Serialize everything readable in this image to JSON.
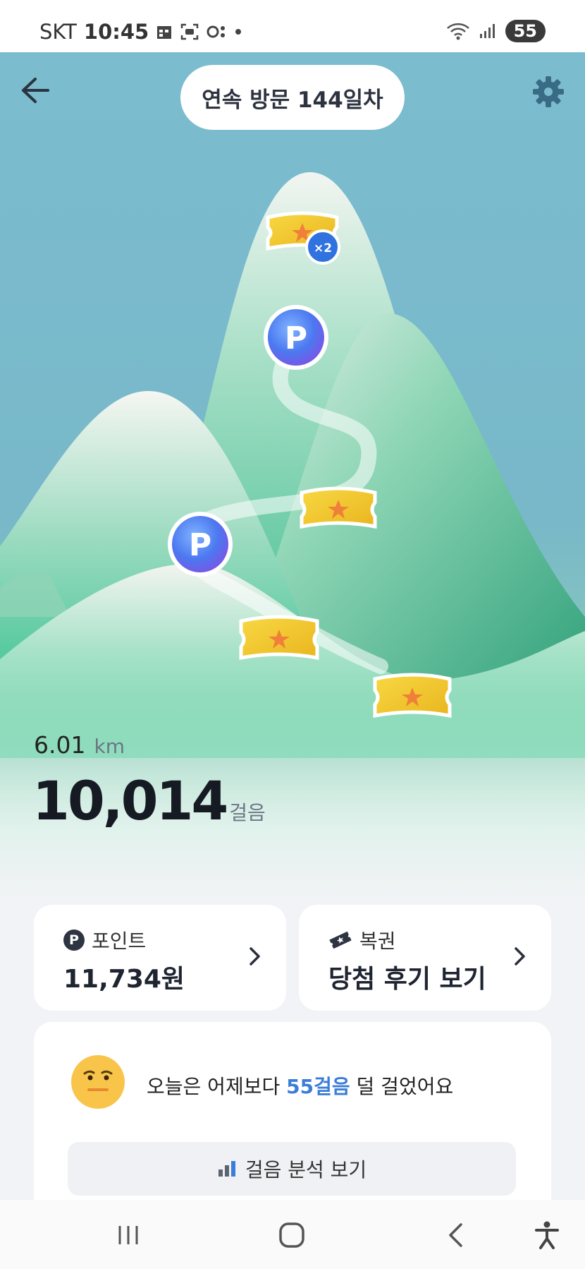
{
  "status_bar": {
    "carrier": "SKT",
    "time": "10:45",
    "battery": "55"
  },
  "header": {
    "streak_label": "연속 방문 144일차"
  },
  "map": {
    "multiplier_badge": "×2",
    "point_marker_label": "P"
  },
  "activity": {
    "distance_value": "6.01",
    "distance_unit": "km",
    "steps_value": "10,014",
    "steps_unit": "걸음"
  },
  "cards": {
    "points": {
      "icon_label": "P",
      "title": "포인트",
      "value": "11,734원"
    },
    "lottery": {
      "title": "복권",
      "value": "당첨 후기 보기"
    }
  },
  "analysis": {
    "compare_prefix": "오늘은 어제보다 ",
    "compare_highlight": "55걸음",
    "compare_suffix": " 덜 걸었어요",
    "button_label": "걸음 분석 보기"
  },
  "colors": {
    "sky": "#7bbccf",
    "mountain_green": "#4cc79a",
    "ticket_gold": "#f5c832",
    "accent_blue": "#3b7dd8"
  }
}
